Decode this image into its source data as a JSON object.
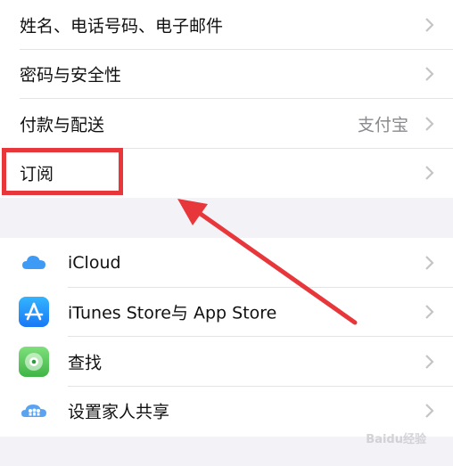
{
  "account_section": {
    "rows": [
      {
        "label": "姓名、电话号码、电子邮件",
        "value": ""
      },
      {
        "label": "密码与安全性",
        "value": ""
      },
      {
        "label": "付款与配送",
        "value": "支付宝"
      },
      {
        "label": "订阅",
        "value": ""
      }
    ]
  },
  "services_section": {
    "rows": [
      {
        "label": "iCloud",
        "icon": "icloud-icon"
      },
      {
        "label": "iTunes Store与 App Store",
        "icon": "app-store-icon"
      },
      {
        "label": "查找",
        "icon": "find-my-icon"
      },
      {
        "label": "设置家人共享",
        "icon": "family-sharing-icon"
      }
    ]
  },
  "watermark": "Baidu经验",
  "colors": {
    "annotation_red": "#e8373a",
    "background": "#f2f2f7",
    "chevron": "#c4c4c7"
  }
}
